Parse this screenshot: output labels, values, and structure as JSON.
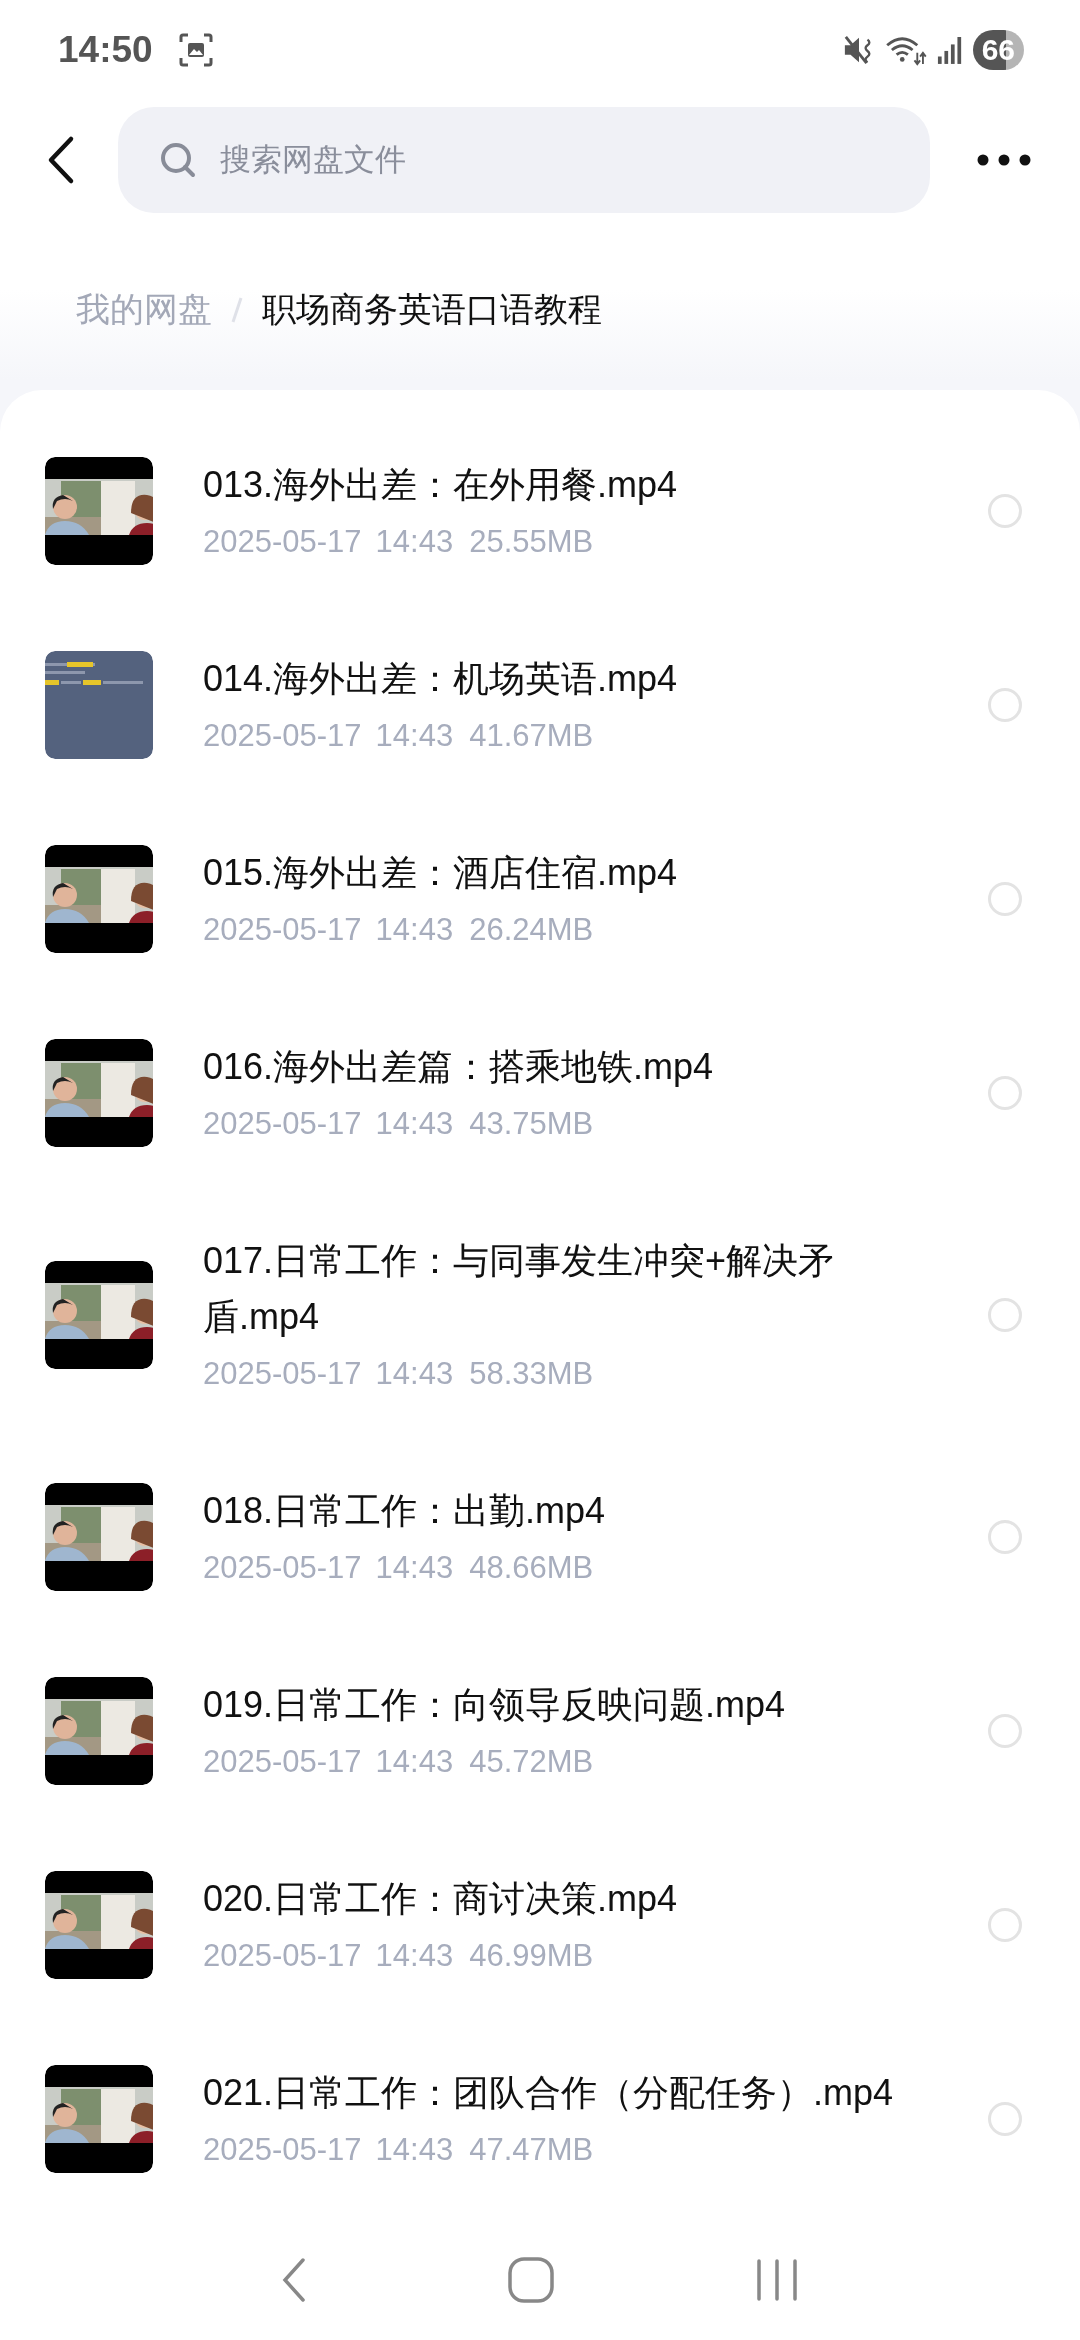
{
  "status_bar": {
    "time": "14:50",
    "battery": "66"
  },
  "search": {
    "placeholder": "搜索网盘文件"
  },
  "breadcrumb": [
    {
      "label": "我的网盘",
      "current": false
    },
    {
      "label": "职场商务英语口语教程",
      "current": true
    }
  ],
  "files": [
    {
      "name": "013.海外出差：在外用餐.mp4",
      "date": "2025-05-17",
      "time": "14:43",
      "size": "25.55MB",
      "selected": false
    },
    {
      "name": "014.海外出差：机场英语.mp4",
      "date": "2025-05-17",
      "time": "14:43",
      "size": "41.67MB",
      "selected": false
    },
    {
      "name": "015.海外出差：酒店住宿.mp4",
      "date": "2025-05-17",
      "time": "14:43",
      "size": "26.24MB",
      "selected": false
    },
    {
      "name": "016.海外出差篇：搭乘地铁.mp4",
      "date": "2025-05-17",
      "time": "14:43",
      "size": "43.75MB",
      "selected": false
    },
    {
      "name": "017.日常工作：与同事发生冲突+解决矛盾.mp4",
      "date": "2025-05-17",
      "time": "14:43",
      "size": "58.33MB",
      "selected": false
    },
    {
      "name": "018.日常工作：出勤.mp4",
      "date": "2025-05-17",
      "time": "14:43",
      "size": "48.66MB",
      "selected": false
    },
    {
      "name": "019.日常工作：向领导反映问题.mp4",
      "date": "2025-05-17",
      "time": "14:43",
      "size": "45.72MB",
      "selected": false
    },
    {
      "name": "020.日常工作：商讨决策.mp4",
      "date": "2025-05-17",
      "time": "14:43",
      "size": "46.99MB",
      "selected": false
    },
    {
      "name": "021.日常工作：团队合作（分配任务）.mp4",
      "date": "2025-05-17",
      "time": "14:43",
      "size": "47.47MB",
      "selected": false
    }
  ]
}
